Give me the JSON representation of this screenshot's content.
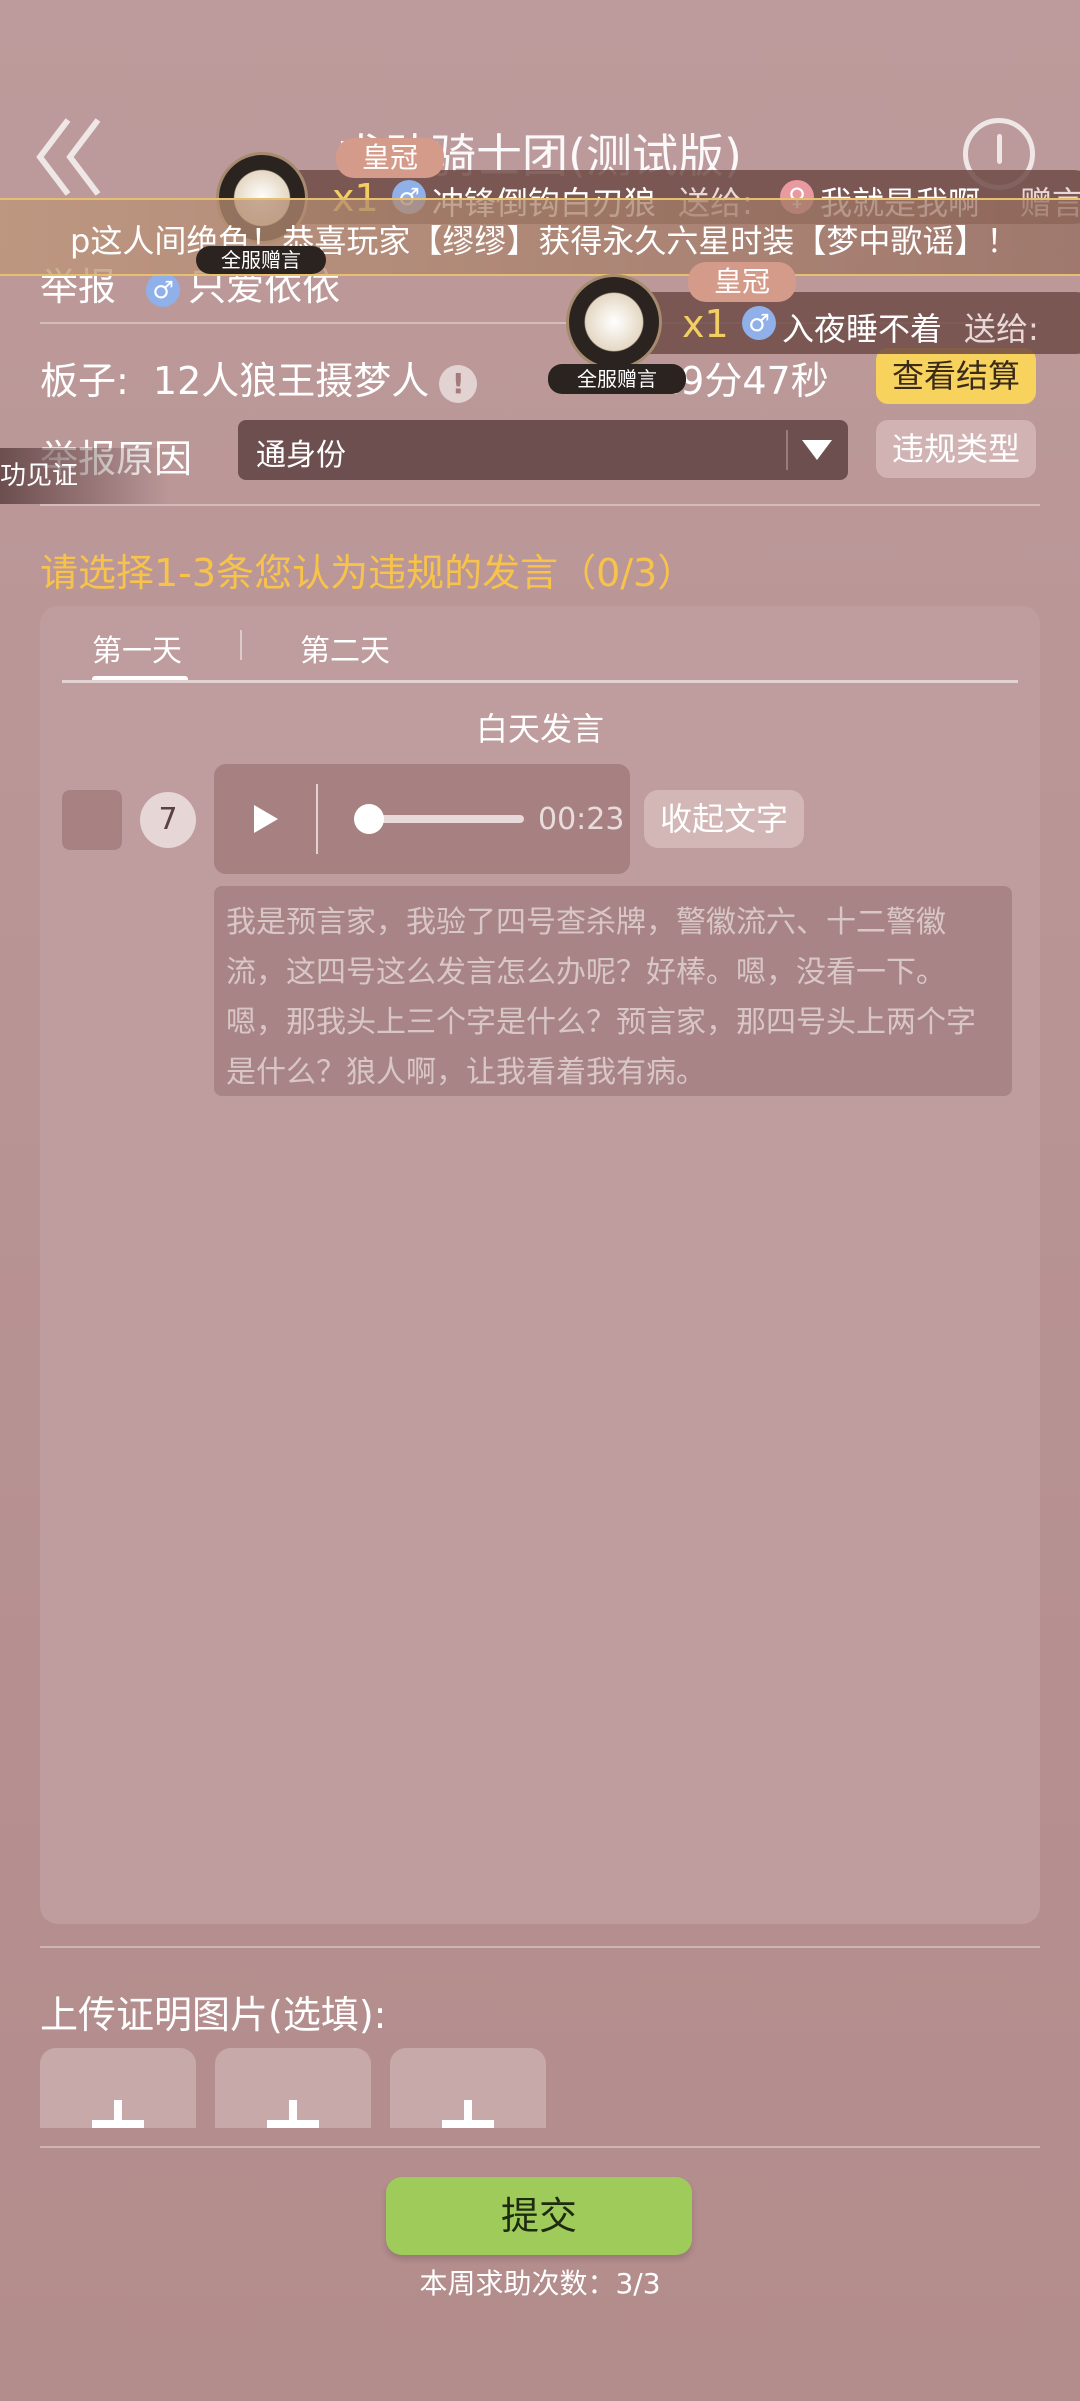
{
  "header": {
    "title": "求助骑士团(测试版)"
  },
  "report": {
    "label": "举报",
    "target_name": "只爱依依"
  },
  "board": {
    "label": "板子:",
    "value": "12人狼王摄梦人",
    "timer_fragment": "19分47秒",
    "settle_button": "查看结算"
  },
  "reason": {
    "label": "举报原因",
    "selected": "通身份",
    "type_button": "违规类型"
  },
  "select_prompt": "请选择1-3条您认为违规的发言（0/3）",
  "tabs": [
    {
      "label": "第一天",
      "active": true
    },
    {
      "label": "第二天",
      "active": false
    }
  ],
  "speech": {
    "section_title": "白天发言",
    "player_number": "7",
    "duration": "00:23",
    "progress": 0.0,
    "collapse_label": "收起文字",
    "transcript": "我是预言家，我验了四号查杀牌，警徽流六、十二警徽流，这四号这么发言怎么办呢？好棒。嗯，没看一下。嗯，那我头上三个字是什么？预言家，那四号头上两个字是什么？狼人啊，让我看着我有病。"
  },
  "upload": {
    "title": "上传证明图片(选填):",
    "slots": 3
  },
  "submit": {
    "label": "提交",
    "quota": "本周求助次数：3/3"
  },
  "overlays": {
    "banner": "p这人间绝色！恭喜玩家【缪缪】获得永久六星时装【梦中歌谣】！",
    "gift1": {
      "tag": "皇冠",
      "count": "x1",
      "sender": "冲锋倒钩白刃狼",
      "send_to": "送给:",
      "receiver": "我就是我啊",
      "extra": "赠言",
      "badge": "全服赠言"
    },
    "gift2": {
      "tag": "皇冠",
      "count": "x1",
      "sender": "入夜睡不着",
      "send_to": "送给:",
      "badge": "全服赠言"
    },
    "side_tag": "功见证"
  },
  "colors": {
    "accent": "#f7c34a",
    "submit": "#9fcb5a",
    "settle": "#f7d25c"
  }
}
